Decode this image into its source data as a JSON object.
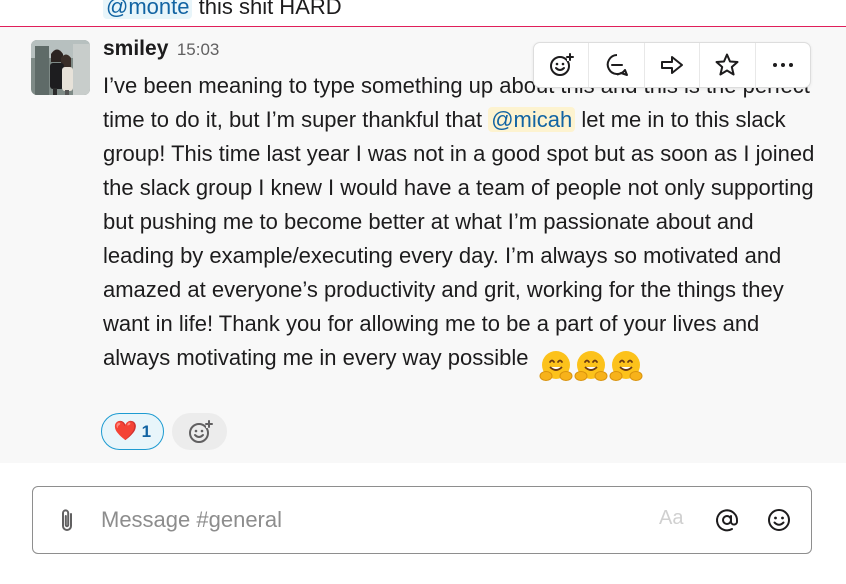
{
  "previous_message": {
    "mention": "@monte",
    "text": "this shit HARD"
  },
  "message": {
    "author": "smiley",
    "time": "15:03",
    "body_part1": "I’ve been meaning to type something up about this and this is the perfect time to do it, but I’m super thankful that",
    "mention": "@micah",
    "body_part2": "let me in to this slack group! This time last year I was not in a good spot but as soon as I joined the slack group I knew I would have a team of people not only supporting but pushing me to become better at what I’m passionate about and leading by example/executing every day. I’m always so motivated and amazed at everyone’s productivity and grit, working for the things they want in life! Thank you for allowing me to be a part of your lives and always motivating me in every way possible",
    "inline_emojis": [
      "hugging-face",
      "hugging-face",
      "hugging-face"
    ],
    "reactions": [
      {
        "emoji": "❤️",
        "name": "heart",
        "count": "1",
        "selected": true
      }
    ]
  },
  "message_actions": [
    "add-reaction-icon",
    "reply-in-thread-icon",
    "share-icon",
    "save-icon",
    "more-actions-icon"
  ],
  "composer": {
    "placeholder": "Message #general",
    "format_label": "Aa"
  },
  "colors": {
    "mention_bg": "#e8f5fa",
    "mention_highlight_bg": "#fdf3d0",
    "link": "#1264a3",
    "new_divider": "#e01e5a",
    "hover_bg": "#f8f8f8"
  }
}
